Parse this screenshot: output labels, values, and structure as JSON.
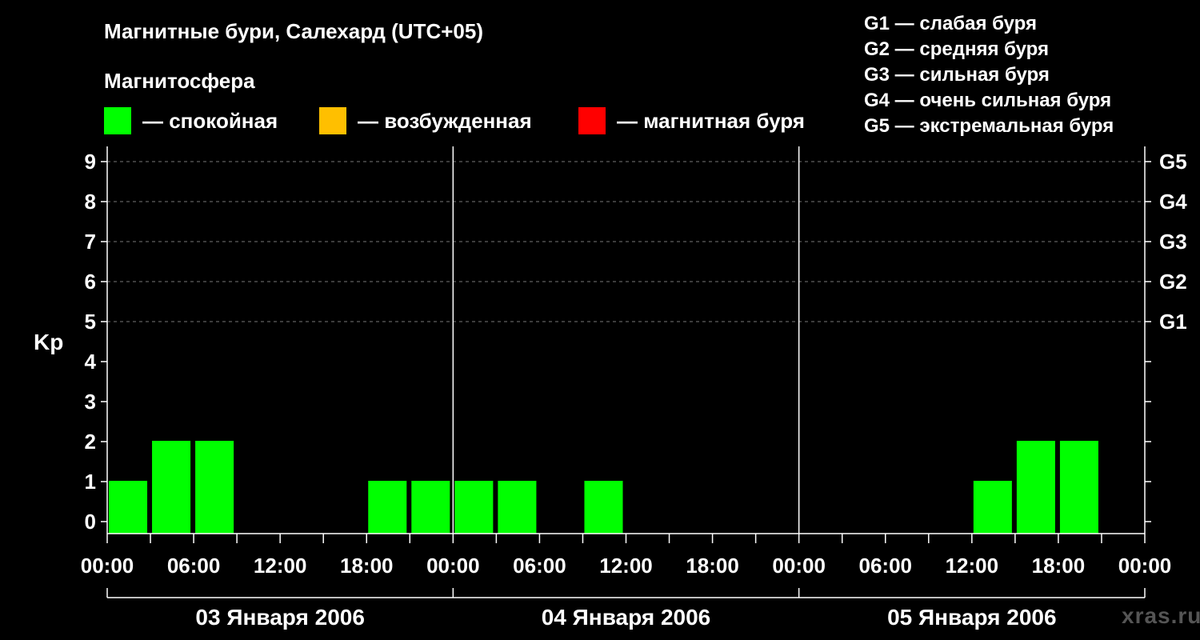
{
  "title": "Магнитные бури, Салехард (UTC+05)",
  "subtitle": "Магнитосфера",
  "legend": [
    {
      "label": "— спокойная",
      "color": "#00ff00"
    },
    {
      "label": "— возбужденная",
      "color": "#ffbf00"
    },
    {
      "label": "— магнитная буря",
      "color": "#ff0000"
    }
  ],
  "g_legend": [
    "G1 — слабая буря",
    "G2 — средняя буря",
    "G3 — сильная буря",
    "G4 — очень сильная буря",
    "G5 — экстремальная буря"
  ],
  "watermark": "xras.ru",
  "chart_data": {
    "type": "bar",
    "ylabel": "Kp",
    "ylim": [
      0,
      9
    ],
    "yticks": [
      0,
      1,
      2,
      3,
      4,
      5,
      6,
      7,
      8,
      9
    ],
    "right_ticks": [
      {
        "kp": 5,
        "label": "G1"
      },
      {
        "kp": 6,
        "label": "G2"
      },
      {
        "kp": 7,
        "label": "G3"
      },
      {
        "kp": 8,
        "label": "G4"
      },
      {
        "kp": 9,
        "label": "G5"
      }
    ],
    "grid": "dashed horizontal at Kp 5-9",
    "x_tick_labels": [
      "00:00",
      "06:00",
      "12:00",
      "18:00",
      "00:00",
      "06:00",
      "12:00",
      "18:00",
      "00:00",
      "06:00",
      "12:00",
      "18:00",
      "00:00"
    ],
    "days": [
      "03 Января 2006",
      "04 Января 2006",
      "05 Января 2006"
    ],
    "interval_hours": 3,
    "bars": [
      {
        "day": 0,
        "start_hour": 0,
        "kp": 1,
        "level": "quiet"
      },
      {
        "day": 0,
        "start_hour": 3,
        "kp": 2,
        "level": "quiet"
      },
      {
        "day": 0,
        "start_hour": 6,
        "kp": 2,
        "level": "quiet"
      },
      {
        "day": 0,
        "start_hour": 9,
        "kp": 0,
        "level": "quiet"
      },
      {
        "day": 0,
        "start_hour": 12,
        "kp": 0,
        "level": "quiet"
      },
      {
        "day": 0,
        "start_hour": 15,
        "kp": 0,
        "level": "quiet"
      },
      {
        "day": 0,
        "start_hour": 18,
        "kp": 1,
        "level": "quiet"
      },
      {
        "day": 0,
        "start_hour": 21,
        "kp": 1,
        "level": "quiet"
      },
      {
        "day": 1,
        "start_hour": 0,
        "kp": 1,
        "level": "quiet"
      },
      {
        "day": 1,
        "start_hour": 3,
        "kp": 1,
        "level": "quiet"
      },
      {
        "day": 1,
        "start_hour": 6,
        "kp": 0,
        "level": "quiet"
      },
      {
        "day": 1,
        "start_hour": 9,
        "kp": 1,
        "level": "quiet"
      },
      {
        "day": 1,
        "start_hour": 12,
        "kp": 0,
        "level": "quiet"
      },
      {
        "day": 1,
        "start_hour": 15,
        "kp": 0,
        "level": "quiet"
      },
      {
        "day": 1,
        "start_hour": 18,
        "kp": 0,
        "level": "quiet"
      },
      {
        "day": 1,
        "start_hour": 21,
        "kp": 0,
        "level": "quiet"
      },
      {
        "day": 2,
        "start_hour": 0,
        "kp": 0,
        "level": "quiet"
      },
      {
        "day": 2,
        "start_hour": 3,
        "kp": 0,
        "level": "quiet"
      },
      {
        "day": 2,
        "start_hour": 6,
        "kp": 0,
        "level": "quiet"
      },
      {
        "day": 2,
        "start_hour": 9,
        "kp": 0,
        "level": "quiet"
      },
      {
        "day": 2,
        "start_hour": 12,
        "kp": 1,
        "level": "quiet"
      },
      {
        "day": 2,
        "start_hour": 15,
        "kp": 2,
        "level": "quiet"
      },
      {
        "day": 2,
        "start_hour": 18,
        "kp": 2,
        "level": "quiet"
      },
      {
        "day": 2,
        "start_hour": 21,
        "kp": 0,
        "level": "quiet"
      }
    ],
    "level_colors": {
      "quiet": "#00ff00",
      "active": "#ffbf00",
      "storm": "#ff0000"
    }
  }
}
